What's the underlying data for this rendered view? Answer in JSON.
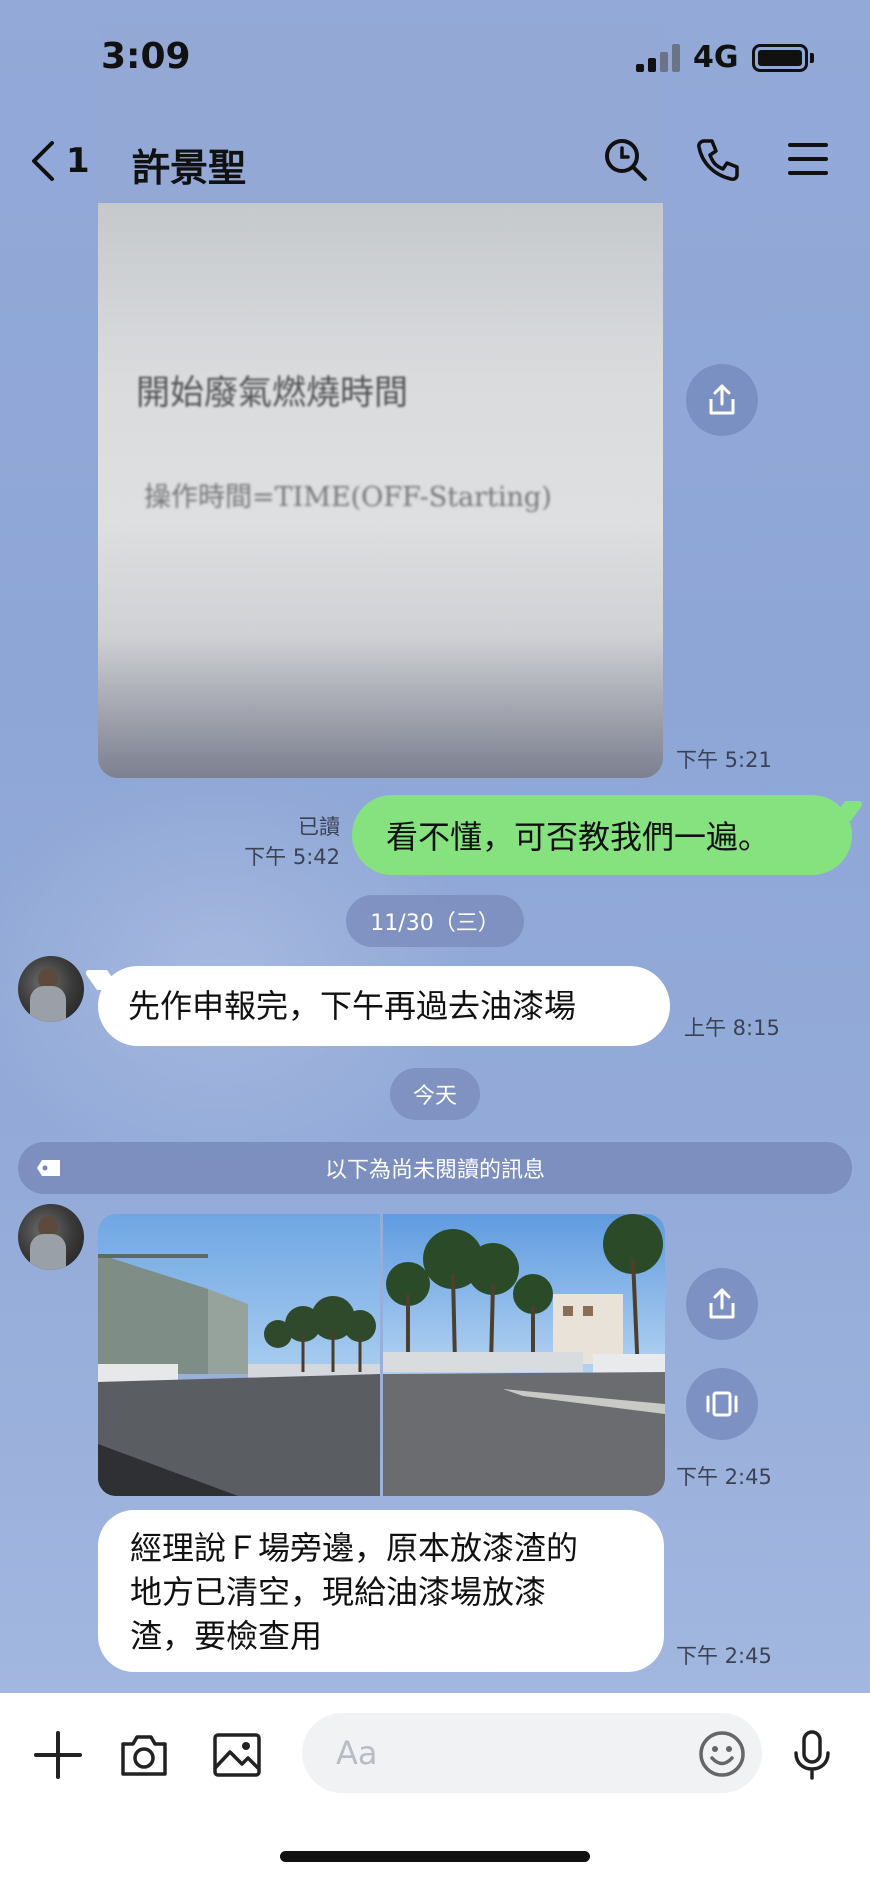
{
  "status_bar": {
    "time": "3:09",
    "network": "4G"
  },
  "header": {
    "back_count": "1",
    "title": "許景聖"
  },
  "messages": {
    "photo1": {
      "doc_line1": "開始廢氣燃燒時間",
      "doc_line2": "操作時間=TIME(OFF-Starting)",
      "time": "下午 5:21"
    },
    "outgoing": {
      "status": "已讀",
      "time": "下午 5:42",
      "text": "看不懂，可否教我們一遍。"
    },
    "date_divider_1": "11/30（三）",
    "incoming1": {
      "text": "先作申報完，下午再過去油漆場",
      "time": "上午 8:15"
    },
    "date_divider_2": "今天",
    "unread_notice": "以下為尚未閱讀的訊息",
    "photos2": {
      "time": "下午 2:45"
    },
    "incoming2": {
      "lines": [
        "經理說Ｆ場旁邊，原本放漆渣的",
        "地方已清空，現給油漆場放漆",
        "渣，要檢查用"
      ],
      "time": "下午 2:45"
    }
  },
  "input_bar": {
    "placeholder": "Aa"
  },
  "icons": {
    "back": "chevron-left-icon",
    "search": "search-icon",
    "call": "phone-icon",
    "menu": "hamburger-menu-icon",
    "share": "share-icon",
    "album": "album-icon",
    "add": "plus-icon",
    "camera": "camera-icon",
    "gallery": "image-icon",
    "emoji": "emoji-icon",
    "mic": "microphone-icon"
  },
  "colors": {
    "chat_bg": "#8fa7d6",
    "outgoing_bubble": "#85e27f",
    "incoming_bubble": "#ffffff"
  }
}
